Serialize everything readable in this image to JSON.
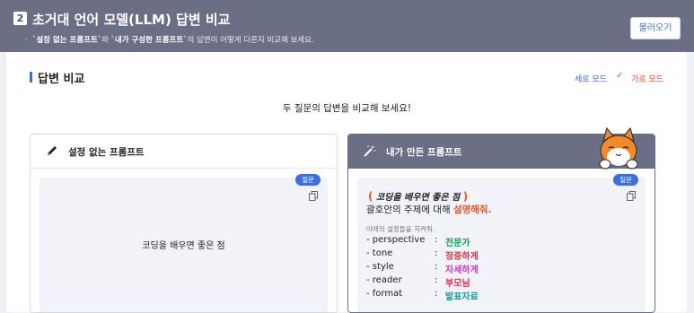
{
  "header": {
    "step": "2",
    "title": "초거대 언어 모델(LLM) 답변 비교",
    "desc_bullet": "·",
    "desc_q1": "`설정 없는 프롬프트`",
    "desc_mid": "와",
    "desc_q2": "`내가 구성한 프롬프트`",
    "desc_tail": "의 답변이 어떻게 다른지 비교해 보세요.",
    "load_button": "불러오기"
  },
  "section": {
    "title": "답변 비교",
    "mode_vertical": "세로 모드",
    "mode_check": "✓",
    "mode_horizontal": "가로 모드"
  },
  "instruction": "두 질문의 답변을 비교해 보세요!",
  "left_card": {
    "title": "설정 없는 프롬프트",
    "badge": "질문",
    "question": "코딩을 배우면 좋은 점"
  },
  "right_card": {
    "title": "내가 만든 프롬프트",
    "badge": "질문",
    "open_paren": "(",
    "heading": "코딩을 배우면 좋은 점",
    "close_paren": ")",
    "line2_prefix": "괄호안의 주제에 대해 ",
    "line2_highlight": "설명해줘.",
    "note": "아래의 설정들을 지켜줘.",
    "settings": [
      {
        "key": "- perspective",
        "colon": ":",
        "value": "전문가",
        "color": "#1a9a4a"
      },
      {
        "key": "- tone",
        "colon": ":",
        "value": "정중하게",
        "color": "#e0304a"
      },
      {
        "key": "- style",
        "colon": ":",
        "value": "자세하게",
        "color": "#c03ad0"
      },
      {
        "key": "- reader",
        "colon": ":",
        "value": "부모님",
        "color": "#e0304a"
      },
      {
        "key": "- format",
        "colon": ":",
        "value": "발표자료",
        "color": "#1a9aa0"
      }
    ]
  },
  "colors": {
    "header_bg": "#6b6f86",
    "accent_blue": "#3d6ee0",
    "accent_orange": "#e8582a"
  }
}
